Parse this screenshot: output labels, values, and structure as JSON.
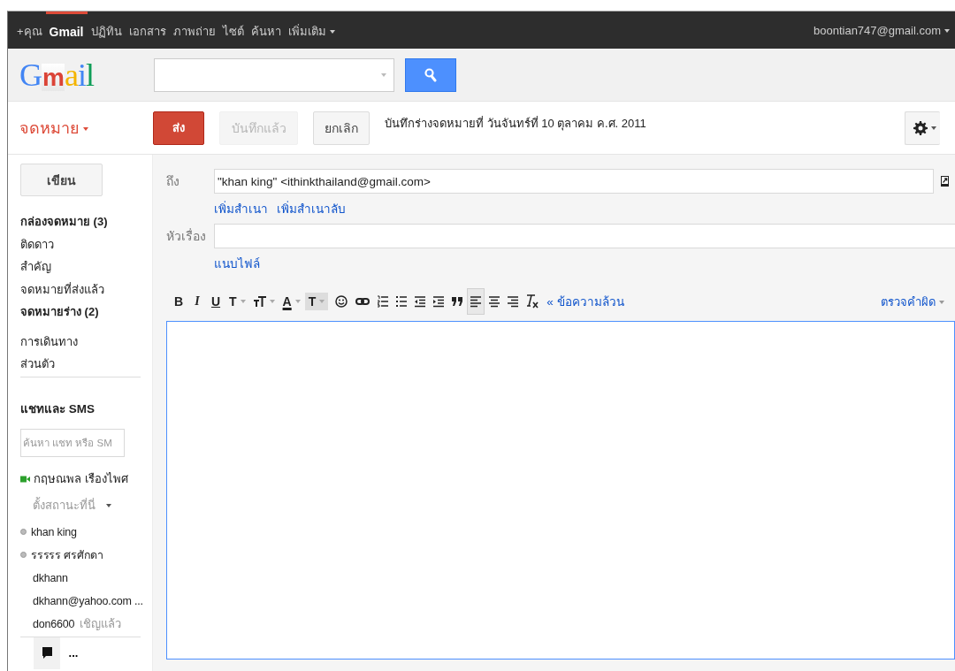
{
  "top_bar": {
    "links": [
      {
        "label": "+คุณ",
        "selected": false,
        "dropdown": false
      },
      {
        "label": "Gmail",
        "selected": true,
        "dropdown": false
      },
      {
        "label": "ปฏิทิน",
        "selected": false,
        "dropdown": false
      },
      {
        "label": "เอกสาร",
        "selected": false,
        "dropdown": false
      },
      {
        "label": "ภาพถ่าย",
        "selected": false,
        "dropdown": false
      },
      {
        "label": "ไซต์",
        "selected": false,
        "dropdown": false
      },
      {
        "label": "ค้นหา",
        "selected": false,
        "dropdown": false
      },
      {
        "label": "เพิ่มเติม",
        "selected": false,
        "dropdown": true
      }
    ],
    "account": "boontian747@gmail.com"
  },
  "header": {
    "logo": "Gmail"
  },
  "mail_menu": {
    "label": "จดหมาย"
  },
  "actions": {
    "buttons": [
      {
        "kind": "primary",
        "label": "ส่ง",
        "disabled": false
      },
      {
        "kind": "plain",
        "label": "บันทึกแล้ว",
        "disabled": true
      },
      {
        "kind": "plain",
        "label": "ยกเลิก",
        "disabled": false
      }
    ],
    "draft_status": "บันทึกร่างจดหมายที่ วันจันทร์ที่ 10 ตุลาคม ค.ศ. 2011"
  },
  "sidebar": {
    "compose": "เขียน",
    "folders": [
      {
        "label": "กล่องจดหมาย (3)",
        "bold": true
      },
      {
        "label": "ติดดาว",
        "bold": false
      },
      {
        "label": "สำคัญ",
        "bold": false
      },
      {
        "label": "จดหมายที่ส่งแล้ว",
        "bold": false
      },
      {
        "label": "จดหมายร่าง (2)",
        "bold": true
      }
    ],
    "labels": [
      {
        "label": "การเดินทาง",
        "bold": false
      },
      {
        "label": "ส่วนตัว",
        "bold": false
      }
    ]
  },
  "chat": {
    "title": "แชทและ SMS",
    "search_placeholder": "ค้นหา แชท หรือ SM",
    "me": {
      "name": "กฤษณพล เรืองไพศ",
      "status": "ตั้งสถานะที่นี่"
    },
    "contacts": [
      {
        "name": "khan king",
        "dot": true
      },
      {
        "name": "รรรรร ศรศักดา",
        "dot": true
      },
      {
        "name": "dkhann",
        "dot": false
      },
      {
        "name": "dkhann@yahoo.com ...",
        "dot": false
      },
      {
        "name": "don6600",
        "dot": false,
        "note": "เชิญแล้ว"
      }
    ],
    "tabs": [
      {
        "kind": "chat",
        "selected": true
      },
      {
        "kind": "more",
        "label": "...",
        "selected": false
      }
    ]
  },
  "compose": {
    "to": {
      "label": "ถึง",
      "value": "\"khan king\" <ithinkthailand@gmail.com>"
    },
    "cc_links": [
      "เพิ่มสำเนา",
      "เพิ่มสำเนาลับ"
    ],
    "subject": {
      "label": "หัวเรื่อง"
    },
    "attach": "แนบไฟล์",
    "toolbar": [
      {
        "kind": "bold",
        "label": "B",
        "selected": false
      },
      {
        "kind": "italic",
        "label": "I",
        "selected": false
      },
      {
        "kind": "underline",
        "label": "U",
        "selected": false
      },
      {
        "kind": "font",
        "label": "T",
        "selected": false
      },
      {
        "kind": "size",
        "selected": false
      },
      {
        "kind": "color",
        "label": "A",
        "selected": false
      },
      {
        "kind": "highlight",
        "label": "T",
        "selected": false
      },
      {
        "kind": "emoji",
        "selected": false
      },
      {
        "kind": "link",
        "selected": false
      },
      {
        "kind": "numbered",
        "selected": false
      },
      {
        "kind": "bulleted",
        "selected": false
      },
      {
        "kind": "outdent",
        "selected": false
      },
      {
        "kind": "indent",
        "selected": false
      },
      {
        "kind": "quote",
        "selected": false
      },
      {
        "kind": "align-left",
        "selected": true
      },
      {
        "kind": "align-center",
        "selected": false
      },
      {
        "kind": "align-right",
        "selected": false
      },
      {
        "kind": "clear",
        "selected": false
      }
    ],
    "plain_text": "« ข้อความล้วน",
    "spellcheck": "ตรวจคำผิด"
  }
}
